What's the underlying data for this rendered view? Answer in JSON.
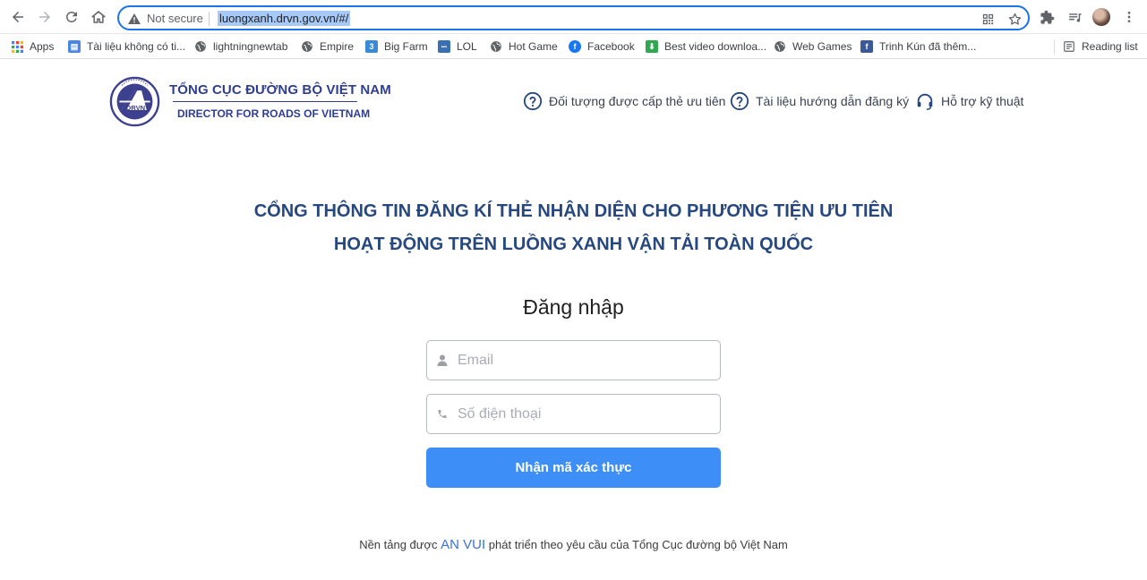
{
  "browser": {
    "not_secure_label": "Not secure",
    "url": "luongxanh.drvn.gov.vn/#/",
    "bookmarks": [
      {
        "label": "Apps",
        "icon": "apps-grid-icon",
        "color": "#5f6368"
      },
      {
        "label": "Tài liệu không có ti...",
        "icon": "docs-icon",
        "color": "#4a86e8"
      },
      {
        "label": "lightningnewtab",
        "icon": "globe-icon",
        "color": "#5f6368"
      },
      {
        "label": "Empire",
        "icon": "globe-icon",
        "color": "#5f6368"
      },
      {
        "label": "Big Farm",
        "icon": "bigfarm-icon",
        "color": "#3b8ad9"
      },
      {
        "label": "LOL",
        "icon": "lol-icon",
        "color": "#3b6fb3"
      },
      {
        "label": "Hot Game",
        "icon": "globe-icon",
        "color": "#5f6368"
      },
      {
        "label": "Facebook",
        "icon": "facebook-icon",
        "color": "#1877f2"
      },
      {
        "label": "Best video downloa...",
        "icon": "download-icon",
        "color": "#2fa84f"
      },
      {
        "label": "Web Games",
        "icon": "globe-icon",
        "color": "#5f6368"
      },
      {
        "label": "Trinh Kún đã thêm...",
        "icon": "facebook-icon",
        "color": "#3b5998"
      }
    ],
    "reading_list_label": "Reading list"
  },
  "header": {
    "brand_title": "TỔNG CỤC ĐƯỜNG BỘ VIỆT NAM",
    "brand_subtitle": "DIRECTOR FOR ROADS OF VIETNAM",
    "logo_text": "DRVN",
    "nav": [
      {
        "label": "Đối tượng được cấp thẻ ưu tiên",
        "icon": "question-circle-icon"
      },
      {
        "label": "Tài liệu hướng dẫn đăng ký",
        "icon": "question-circle-icon"
      },
      {
        "label": "Hỗ trợ kỹ thuật",
        "icon": "headset-icon"
      }
    ]
  },
  "main": {
    "headline_line1": "CỔNG THÔNG TIN ĐĂNG KÍ THẺ NHẬN DIỆN CHO PHƯƠNG TIỆN ƯU TIÊN",
    "headline_line2": "HOẠT ĐỘNG TRÊN LUỒNG XANH VẬN TẢI TOÀN QUỐC",
    "login_title": "Đăng nhập",
    "email": {
      "placeholder": "Email",
      "value": "",
      "icon": "user-icon"
    },
    "phone": {
      "placeholder": "Số điện thoại",
      "value": "",
      "icon": "phone-icon"
    },
    "submit_label": "Nhận mã xác thực"
  },
  "footer": {
    "prefix": "Nền tảng được",
    "brand": "AN VUI",
    "suffix": "phát triển theo yêu cầu của Tổng Cục đường bộ Việt Nam"
  },
  "colors": {
    "brand_blue": "#2f3d91",
    "headline_blue": "#27487f",
    "button_blue": "#3d8ef7",
    "link_blue": "#3b72d9"
  }
}
